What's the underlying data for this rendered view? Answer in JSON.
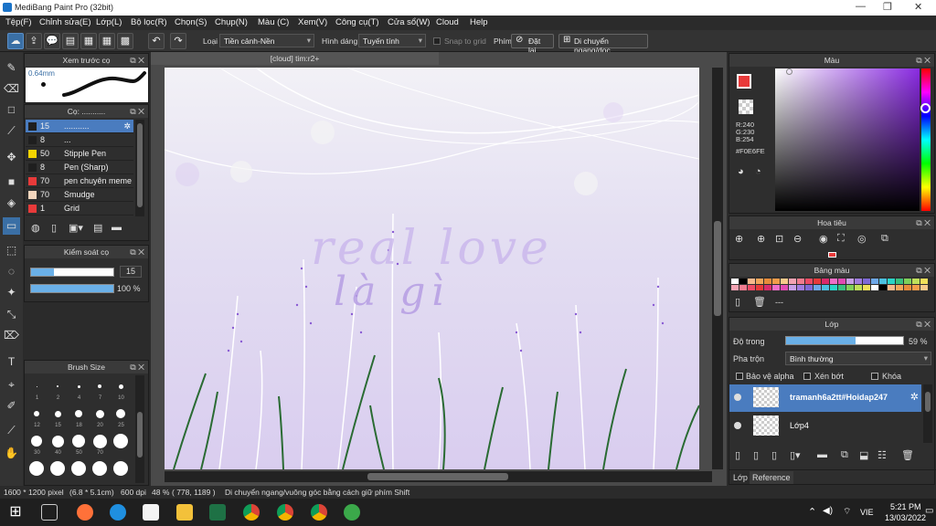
{
  "window": {
    "title": "MediBang Paint Pro (32bit)"
  },
  "menu": [
    "Tệp(F)",
    "Chỉnh sửa(E)",
    "Lớp(L)",
    "Bộ lọc(R)",
    "Chọn(S)",
    "Chụp(N)",
    "Màu (C)",
    "Xem(V)",
    "Công cụ(T)",
    "Cửa sổ(W)",
    "Cloud",
    "Help"
  ],
  "toolbar": {
    "type_label": "Loại",
    "type_value": "Tiền cảnh-Nền",
    "shape_label": "Hình dáng",
    "shape_value": "Tuyến tính",
    "snap_label": "Snap to grid",
    "key_label": "Phím",
    "reset_label": "Đặt lại",
    "move_label": "Di chuyển ngang/dọc"
  },
  "preview": {
    "title": "Xem trước cọ",
    "size": "0.64mm"
  },
  "brushes": {
    "title": "Cọ: ...........",
    "items": [
      {
        "size": "15",
        "name": "...........",
        "color": "#1f1f1f",
        "selected": true
      },
      {
        "size": "8",
        "name": "...",
        "color": "#1f1f1f"
      },
      {
        "size": "50",
        "name": "Stipple Pen",
        "color": "#f4d400"
      },
      {
        "size": "8",
        "name": "Pen (Sharp)",
        "color": "#1f1f1f"
      },
      {
        "size": "70",
        "name": "pen chuyên meme",
        "color": "#e83a3a"
      },
      {
        "size": "70",
        "name": "Smudge",
        "color": "#f3d6bd"
      },
      {
        "size": "1",
        "name": "Grid",
        "color": "#e83a3a"
      }
    ]
  },
  "brush_control": {
    "title": "Kiểm soát cọ",
    "size": "15",
    "opacity": "100 %"
  },
  "brush_size": {
    "title": "Brush Size",
    "labels": [
      "1",
      "2",
      "4",
      "7",
      "10",
      "12",
      "15",
      "18",
      "20",
      "25",
      "30",
      "40",
      "50",
      "70"
    ]
  },
  "canvas": {
    "tab": "[cloud] tim:r2+",
    "text_line1": "real love",
    "text_line2": "là gì"
  },
  "color_panel": {
    "title": "Màu",
    "r": "R:240",
    "g": "G:230",
    "b": "B:254",
    "hex": "#F0E6FE"
  },
  "navigator": {
    "title": "Hoa tiêu"
  },
  "palette": {
    "title": "Bảng màu",
    "more": "---"
  },
  "layers": {
    "title": "Lớp",
    "opacity_label": "Độ trong",
    "opacity_value": "59 %",
    "blend_label": "Pha trộn",
    "blend_value": "Bình thường",
    "protect_alpha": "Bảo vệ alpha",
    "clip": "Xén bớt",
    "lock": "Khóa",
    "items": [
      {
        "name": "tramanh6a2tt#Hoidap247",
        "selected": true
      },
      {
        "name": "Lớp4",
        "selected": false
      }
    ],
    "tab_layer": "Lớp",
    "tab_reference": "Reference"
  },
  "status": {
    "dims": "1600 * 1200 pixel",
    "size": "(6.8 * 5.1cm)",
    "dpi": "600 dpi",
    "zoom": "48 %",
    "coords": "( 778, 1189 )",
    "hint": "Di chuyển ngang/vuông góc bằng cách giữ phím Shift"
  },
  "taskbar": {
    "lang": "VIE",
    "time": "5:21 PM",
    "date": "13/03/2022"
  },
  "colors": {
    "accent": "#3a6fa5",
    "selected": "#4a7cbf",
    "fg_color": "#e83a3a",
    "bg_color": "#b89be0"
  }
}
